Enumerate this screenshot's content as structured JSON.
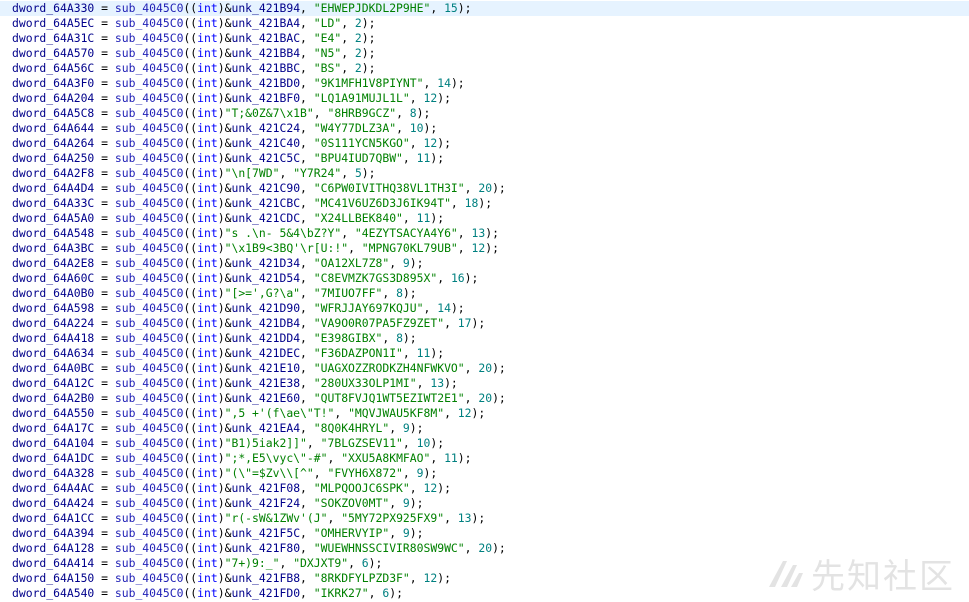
{
  "code": {
    "lines": [
      {
        "var": "dword_64A330",
        "fn": "sub_4045C0",
        "kind": "unk",
        "arg": "unk_421B94",
        "str": "\"EHWEPJDKDL2P9HE\"",
        "num": "15"
      },
      {
        "var": "dword_64A5EC",
        "fn": "sub_4045C0",
        "kind": "unk",
        "arg": "unk_421BA4",
        "str": "\"LD\"",
        "num": "2"
      },
      {
        "var": "dword_64A31C",
        "fn": "sub_4045C0",
        "kind": "unk",
        "arg": "unk_421BAC",
        "str": "\"E4\"",
        "num": "2"
      },
      {
        "var": "dword_64A570",
        "fn": "sub_4045C0",
        "kind": "unk",
        "arg": "unk_421BB4",
        "str": "\"N5\"",
        "num": "2"
      },
      {
        "var": "dword_64A56C",
        "fn": "sub_4045C0",
        "kind": "unk",
        "arg": "unk_421BBC",
        "str": "\"BS\"",
        "num": "2"
      },
      {
        "var": "dword_64A3F0",
        "fn": "sub_4045C0",
        "kind": "unk",
        "arg": "unk_421BD0",
        "str": "\"9K1MFH1V8PIYNT\"",
        "num": "14"
      },
      {
        "var": "dword_64A204",
        "fn": "sub_4045C0",
        "kind": "unk",
        "arg": "unk_421BF0",
        "str": "\"LQ1A91MUJL1L\"",
        "num": "12"
      },
      {
        "var": "dword_64A5C8",
        "fn": "sub_4045C0",
        "kind": "lit",
        "arg": "\"T;&0Z&7\\x1B\"",
        "str": "\"8HRB9GCZ\"",
        "num": "8"
      },
      {
        "var": "dword_64A644",
        "fn": "sub_4045C0",
        "kind": "unk",
        "arg": "unk_421C24",
        "str": "\"W4Y77DLZ3A\"",
        "num": "10"
      },
      {
        "var": "dword_64A264",
        "fn": "sub_4045C0",
        "kind": "unk",
        "arg": "unk_421C40",
        "str": "\"0S111YCN5KGO\"",
        "num": "12"
      },
      {
        "var": "dword_64A250",
        "fn": "sub_4045C0",
        "kind": "unk",
        "arg": "unk_421C5C",
        "str": "\"BPU4IUD7QBW\"",
        "num": "11"
      },
      {
        "var": "dword_64A2F8",
        "fn": "sub_4045C0",
        "kind": "lit",
        "arg": "\"\\n[7WD\"",
        "str": "\"Y7R24\"",
        "num": "5"
      },
      {
        "var": "dword_64A4D4",
        "fn": "sub_4045C0",
        "kind": "unk",
        "arg": "unk_421C90",
        "str": "\"C6PW0IVITHQ38VL1TH3I\"",
        "num": "20"
      },
      {
        "var": "dword_64A33C",
        "fn": "sub_4045C0",
        "kind": "unk",
        "arg": "unk_421CBC",
        "str": "\"MC41V6UZ6D3J6IK94T\"",
        "num": "18"
      },
      {
        "var": "dword_64A5A0",
        "fn": "sub_4045C0",
        "kind": "unk",
        "arg": "unk_421CDC",
        "str": "\"X24LLBEK840\"",
        "num": "11"
      },
      {
        "var": "dword_64A548",
        "fn": "sub_4045C0",
        "kind": "lit",
        "arg": "\"s .\\n- 5&4\\bZ?Y\"",
        "str": "\"4EZYTSACYA4Y6\"",
        "num": "13"
      },
      {
        "var": "dword_64A3BC",
        "fn": "sub_4045C0",
        "kind": "lit",
        "arg": "\"\\x1B9<3BQ'\\r[U:!\"",
        "str": "\"MPNG70KL79UB\"",
        "num": "12"
      },
      {
        "var": "dword_64A2E8",
        "fn": "sub_4045C0",
        "kind": "unk",
        "arg": "unk_421D34",
        "str": "\"OA12XL7Z8\"",
        "num": "9"
      },
      {
        "var": "dword_64A60C",
        "fn": "sub_4045C0",
        "kind": "unk",
        "arg": "unk_421D54",
        "str": "\"C8EVMZK7GS3D895X\"",
        "num": "16"
      },
      {
        "var": "dword_64A0B0",
        "fn": "sub_4045C0",
        "kind": "lit",
        "arg": "\"[>=',G?\\a\"",
        "str": "\"7MIUO7FF\"",
        "num": "8"
      },
      {
        "var": "dword_64A598",
        "fn": "sub_4045C0",
        "kind": "unk",
        "arg": "unk_421D90",
        "str": "\"WFRJJAY697KQJU\"",
        "num": "14"
      },
      {
        "var": "dword_64A224",
        "fn": "sub_4045C0",
        "kind": "unk",
        "arg": "unk_421DB4",
        "str": "\"VA9O0R07PA5FZ9ZET\"",
        "num": "17"
      },
      {
        "var": "dword_64A418",
        "fn": "sub_4045C0",
        "kind": "unk",
        "arg": "unk_421DD4",
        "str": "\"E398GIBX\"",
        "num": "8"
      },
      {
        "var": "dword_64A634",
        "fn": "sub_4045C0",
        "kind": "unk",
        "arg": "unk_421DEC",
        "str": "\"F36DAZPON1I\"",
        "num": "11"
      },
      {
        "var": "dword_64A0BC",
        "fn": "sub_4045C0",
        "kind": "unk",
        "arg": "unk_421E10",
        "str": "\"UAGXOZZRODKZH4NFWKVO\"",
        "num": "20"
      },
      {
        "var": "dword_64A12C",
        "fn": "sub_4045C0",
        "kind": "unk",
        "arg": "unk_421E38",
        "str": "\"280UX33OLP1MI\"",
        "num": "13"
      },
      {
        "var": "dword_64A2B0",
        "fn": "sub_4045C0",
        "kind": "unk",
        "arg": "unk_421E60",
        "str": "\"QUT8FVJQ1WT5EZIWT2E1\"",
        "num": "20"
      },
      {
        "var": "dword_64A550",
        "fn": "sub_4045C0",
        "kind": "lit",
        "arg": "\",5 +'(f\\ae\\\"T!\"",
        "str": "\"MQVJWAU5KF8M\"",
        "num": "12"
      },
      {
        "var": "dword_64A17C",
        "fn": "sub_4045C0",
        "kind": "unk",
        "arg": "unk_421EA4",
        "str": "\"8Q0K4HRYL\"",
        "num": "9"
      },
      {
        "var": "dword_64A104",
        "fn": "sub_4045C0",
        "kind": "lit",
        "arg": "\"B1)5iak2]]\"",
        "str": "\"7BLGZSEV11\"",
        "num": "10"
      },
      {
        "var": "dword_64A1DC",
        "fn": "sub_4045C0",
        "kind": "lit",
        "arg": "\";*,E5\\vyc\\\"-#\"",
        "str": "\"XXU5A8KMFAO\"",
        "num": "11"
      },
      {
        "var": "dword_64A328",
        "fn": "sub_4045C0",
        "kind": "lit",
        "arg": "\"(\\\"=$Zv\\\\[^\"",
        "str": "\"FVYH6X872\"",
        "num": "9"
      },
      {
        "var": "dword_64A4AC",
        "fn": "sub_4045C0",
        "kind": "unk",
        "arg": "unk_421F08",
        "str": "\"MLPQOOJC6SPK\"",
        "num": "12"
      },
      {
        "var": "dword_64A424",
        "fn": "sub_4045C0",
        "kind": "unk",
        "arg": "unk_421F24",
        "str": "\"SOKZOV0MT\"",
        "num": "9"
      },
      {
        "var": "dword_64A1CC",
        "fn": "sub_4045C0",
        "kind": "lit",
        "arg": "\"r(-sW&1ZWv'(J\"",
        "str": "\"5MY72PX925FX9\"",
        "num": "13"
      },
      {
        "var": "dword_64A394",
        "fn": "sub_4045C0",
        "kind": "unk",
        "arg": "unk_421F5C",
        "str": "\"OMHERVYIP\"",
        "num": "9"
      },
      {
        "var": "dword_64A128",
        "fn": "sub_4045C0",
        "kind": "unk",
        "arg": "unk_421F80",
        "str": "\"WUEWHNSSCIVIR80SW9WC\"",
        "num": "20"
      },
      {
        "var": "dword_64A414",
        "fn": "sub_4045C0",
        "kind": "lit",
        "arg": "\"7+)9:_\"",
        "str": "\"DXJXT9\"",
        "num": "6"
      },
      {
        "var": "dword_64A150",
        "fn": "sub_4045C0",
        "kind": "unk",
        "arg": "unk_421FB8",
        "str": "\"8RKDFYLPZD3F\"",
        "num": "12"
      },
      {
        "var": "dword_64A540",
        "fn": "sub_4045C0",
        "kind": "unk",
        "arg": "unk_421FD0",
        "str": "\"IKRK27\"",
        "num": "6"
      }
    ],
    "highlighted_line": 0,
    "cast_keyword": "int"
  },
  "watermark": {
    "text": "先知社区",
    "icon": "xianzhi-logo-icon"
  },
  "colors": {
    "variable": "#00008b",
    "function": "#1f1fb6",
    "keyword": "#0000ff",
    "string": "#008000",
    "number": "#008080",
    "highlight": "#e6f3ff"
  }
}
